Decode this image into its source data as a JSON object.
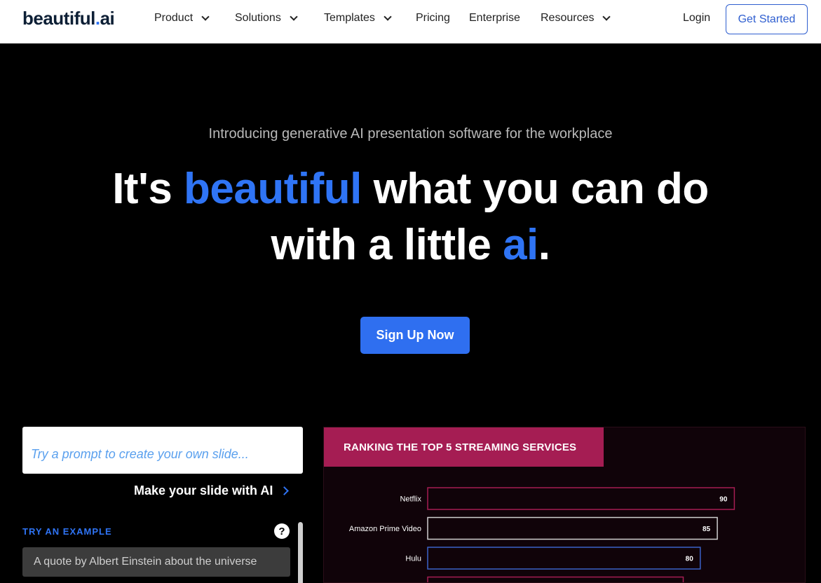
{
  "nav": {
    "logo_main": "beautiful",
    "logo_dot": ".",
    "logo_ai": "ai",
    "items": [
      {
        "label": "Product",
        "dropdown": true
      },
      {
        "label": "Solutions",
        "dropdown": true
      },
      {
        "label": "Templates",
        "dropdown": true
      },
      {
        "label": "Pricing",
        "dropdown": false
      },
      {
        "label": "Enterprise",
        "dropdown": false
      },
      {
        "label": "Resources",
        "dropdown": true
      }
    ],
    "login": "Login",
    "get_started": "Get Started"
  },
  "hero": {
    "intro": "Introducing generative AI presentation software for the workplace",
    "line1_pre": "It's ",
    "line1_highlight": "beautiful",
    "line1_post": " what you can do",
    "line2_pre": "with a little ",
    "line2_highlight": "ai",
    "line2_post": ".",
    "cta": "Sign Up Now"
  },
  "prompt": {
    "placeholder": "Try a prompt to create your own slide...",
    "value": "",
    "make_slide": "Make your slide with AI",
    "try_example": "TRY AN EXAMPLE",
    "help": "?",
    "examples": [
      "A quote by Albert Einstein about the universe"
    ]
  },
  "colors": {
    "accent": "#2f74f5",
    "slide_title_bg": "#a51d53"
  },
  "chart_data": {
    "type": "bar",
    "title": "RANKING THE TOP 5 STREAMING SERVICES",
    "categories": [
      "Netflix",
      "Amazon Prime Video",
      "Hulu",
      ""
    ],
    "values": [
      90,
      85,
      80,
      75
    ],
    "bar_colors": [
      "#a51d53",
      "#cfcfcf",
      "#3b62c9",
      "#a51d53"
    ],
    "xlim": [
      0,
      100
    ],
    "grid": false
  }
}
